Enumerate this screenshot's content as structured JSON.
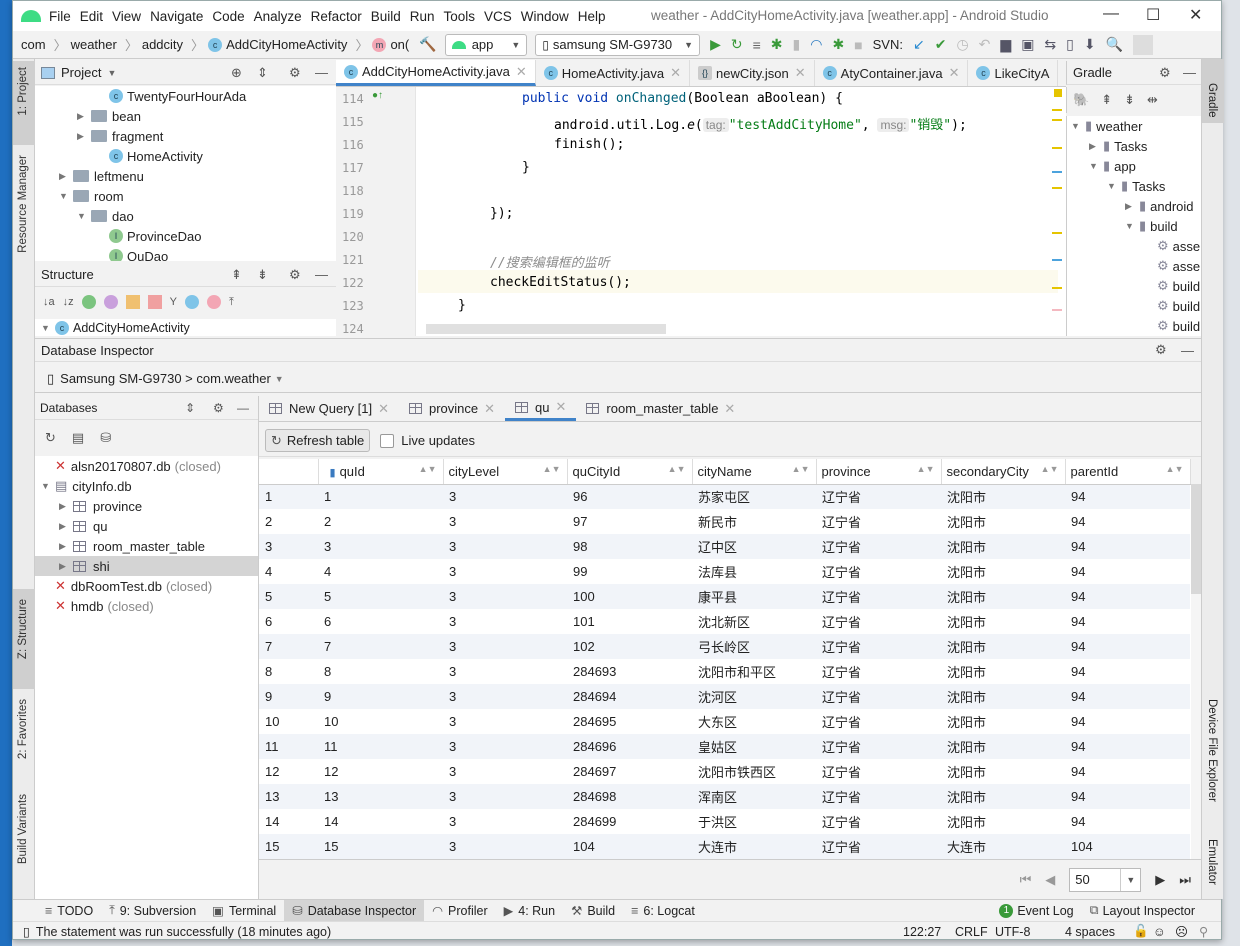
{
  "window": {
    "title": "weather - AddCityHomeActivity.java [weather.app] - Android Studio"
  },
  "menu": [
    "File",
    "Edit",
    "View",
    "Navigate",
    "Code",
    "Analyze",
    "Refactor",
    "Build",
    "Run",
    "Tools",
    "VCS",
    "Window",
    "Help"
  ],
  "breadcrumb": [
    "com",
    "weather",
    "addcity",
    "AddCityHomeActivity",
    "on("
  ],
  "toolbar": {
    "run_config": "app",
    "device": "samsung SM-G9730",
    "svn_label": "SVN:"
  },
  "left_stripe": [
    "1: Project",
    "Resource Manager",
    "Z: Structure",
    "2: Favorites",
    "Build Variants"
  ],
  "right_stripe": [
    "Gradle",
    "Device File Explorer",
    "Emulator"
  ],
  "project": {
    "title": "Project",
    "items": [
      {
        "label": "TwentyFourHourAda",
        "type": "class",
        "indent": 3
      },
      {
        "label": "bean",
        "type": "folder",
        "indent": 2
      },
      {
        "label": "fragment",
        "type": "folder",
        "indent": 2
      },
      {
        "label": "HomeActivity",
        "type": "class",
        "indent": 3
      },
      {
        "label": "leftmenu",
        "type": "folder",
        "indent": 1
      },
      {
        "label": "room",
        "type": "folder",
        "indent": 1,
        "open": true
      },
      {
        "label": "dao",
        "type": "folder",
        "indent": 2,
        "open": true
      },
      {
        "label": "ProvinceDao",
        "type": "interface",
        "indent": 3
      },
      {
        "label": "QuDao",
        "type": "interface",
        "indent": 3
      }
    ]
  },
  "structure": {
    "title": "Structure",
    "root": "AddCityHomeActivity"
  },
  "editor": {
    "tabs": [
      "AddCityHomeActivity.java",
      "HomeActivity.java",
      "newCity.json",
      "AtyContainer.java",
      "LikeCityA"
    ],
    "active_tab": 0,
    "line_numbers": [
      "114",
      "115",
      "116",
      "117",
      "118",
      "119",
      "120",
      "121",
      "122",
      "123",
      "124"
    ],
    "code": {
      "l114_kw": "public void ",
      "l114_fn": "onChanged",
      "l114_rest": "(Boolean aBoolean) {",
      "l115_a": "android.util.Log.",
      "l115_e": "e",
      "l115_b": "(",
      "l115_tag": "tag:",
      "l115_tagv": "\"testAddCityHome\"",
      "l115_c": ", ",
      "l115_msg": "msg:",
      "l115_msgv": "\"销毁\"",
      "l115_d": ");",
      "l116": "finish();",
      "l117": "}",
      "l119": "});",
      "l121": "//搜索编辑框的监听",
      "l122": "checkEditStatus();",
      "l123": "}"
    }
  },
  "gradle": {
    "title": "Gradle",
    "items": [
      {
        "label": "weather",
        "indent": 0
      },
      {
        "label": "Tasks",
        "indent": 1
      },
      {
        "label": "app",
        "indent": 1
      },
      {
        "label": "Tasks",
        "indent": 2
      },
      {
        "label": "android",
        "indent": 3
      },
      {
        "label": "build",
        "indent": 3
      },
      {
        "label": "asse",
        "indent": 4
      },
      {
        "label": "asse",
        "indent": 4
      },
      {
        "label": "build",
        "indent": 4
      },
      {
        "label": "build",
        "indent": 4
      },
      {
        "label": "build",
        "indent": 4
      }
    ]
  },
  "db_inspector": {
    "title": "Database Inspector",
    "process": "Samsung SM-G9730 > com.weather",
    "databases_title": "Databases",
    "databases": [
      {
        "label": "alsn20170807.db",
        "suffix": "(closed)",
        "type": "db-closed",
        "indent": 0
      },
      {
        "label": "cityInfo.db",
        "suffix": "",
        "type": "db",
        "indent": 0
      },
      {
        "label": "province",
        "suffix": "",
        "type": "table",
        "indent": 1
      },
      {
        "label": "qu",
        "suffix": "",
        "type": "table",
        "indent": 1
      },
      {
        "label": "room_master_table",
        "suffix": "",
        "type": "table",
        "indent": 1
      },
      {
        "label": "shi",
        "suffix": "",
        "type": "table",
        "indent": 1,
        "selected": true
      },
      {
        "label": "dbRoomTest.db",
        "suffix": "(closed)",
        "type": "db-closed",
        "indent": 0
      },
      {
        "label": "hmdb",
        "suffix": "(closed)",
        "type": "db-closed",
        "indent": 0
      }
    ],
    "tabs": [
      "New Query [1]",
      "province",
      "qu",
      "room_master_table"
    ],
    "active_tab": 2,
    "refresh_label": "Refresh table",
    "live_updates_label": "Live updates",
    "live_updates": false,
    "columns": [
      "",
      "quId",
      "cityLevel",
      "quCityId",
      "cityName",
      "province",
      "secondaryCity",
      "parentId"
    ],
    "rows": [
      [
        "1",
        "1",
        "3",
        "96",
        "苏家屯区",
        "辽宁省",
        "沈阳市",
        "94"
      ],
      [
        "2",
        "2",
        "3",
        "97",
        "新民市",
        "辽宁省",
        "沈阳市",
        "94"
      ],
      [
        "3",
        "3",
        "3",
        "98",
        "辽中区",
        "辽宁省",
        "沈阳市",
        "94"
      ],
      [
        "4",
        "4",
        "3",
        "99",
        "法库县",
        "辽宁省",
        "沈阳市",
        "94"
      ],
      [
        "5",
        "5",
        "3",
        "100",
        "康平县",
        "辽宁省",
        "沈阳市",
        "94"
      ],
      [
        "6",
        "6",
        "3",
        "101",
        "沈北新区",
        "辽宁省",
        "沈阳市",
        "94"
      ],
      [
        "7",
        "7",
        "3",
        "102",
        "弓长岭区",
        "辽宁省",
        "沈阳市",
        "94"
      ],
      [
        "8",
        "8",
        "3",
        "284693",
        "沈阳市和平区",
        "辽宁省",
        "沈阳市",
        "94"
      ],
      [
        "9",
        "9",
        "3",
        "284694",
        "沈河区",
        "辽宁省",
        "沈阳市",
        "94"
      ],
      [
        "10",
        "10",
        "3",
        "284695",
        "大东区",
        "辽宁省",
        "沈阳市",
        "94"
      ],
      [
        "11",
        "11",
        "3",
        "284696",
        "皇姑区",
        "辽宁省",
        "沈阳市",
        "94"
      ],
      [
        "12",
        "12",
        "3",
        "284697",
        "沈阳市铁西区",
        "辽宁省",
        "沈阳市",
        "94"
      ],
      [
        "13",
        "13",
        "3",
        "284698",
        "浑南区",
        "辽宁省",
        "沈阳市",
        "94"
      ],
      [
        "14",
        "14",
        "3",
        "284699",
        "于洪区",
        "辽宁省",
        "沈阳市",
        "94"
      ],
      [
        "15",
        "15",
        "3",
        "104",
        "大连市",
        "辽宁省",
        "大连市",
        "104"
      ]
    ],
    "page_size": "50"
  },
  "bottom_tools": [
    "TODO",
    "9: Subversion",
    "Terminal",
    "Database Inspector",
    "Profiler",
    "4: Run",
    "Build",
    "6: Logcat"
  ],
  "bottom_active": 3,
  "bottom_right_tools": [
    "Event Log",
    "Layout Inspector"
  ],
  "event_log_count": "1",
  "status": {
    "message": "The statement was run successfully (18 minutes ago)",
    "position": "122:27",
    "line_sep": "CRLF",
    "encoding": "UTF-8",
    "indent": "4 spaces"
  },
  "colors": {
    "accent": "#4083c9",
    "android_green": "#3ddc84",
    "selected_row": "#d4d4d4",
    "alt_row": "#f1f4f9"
  }
}
